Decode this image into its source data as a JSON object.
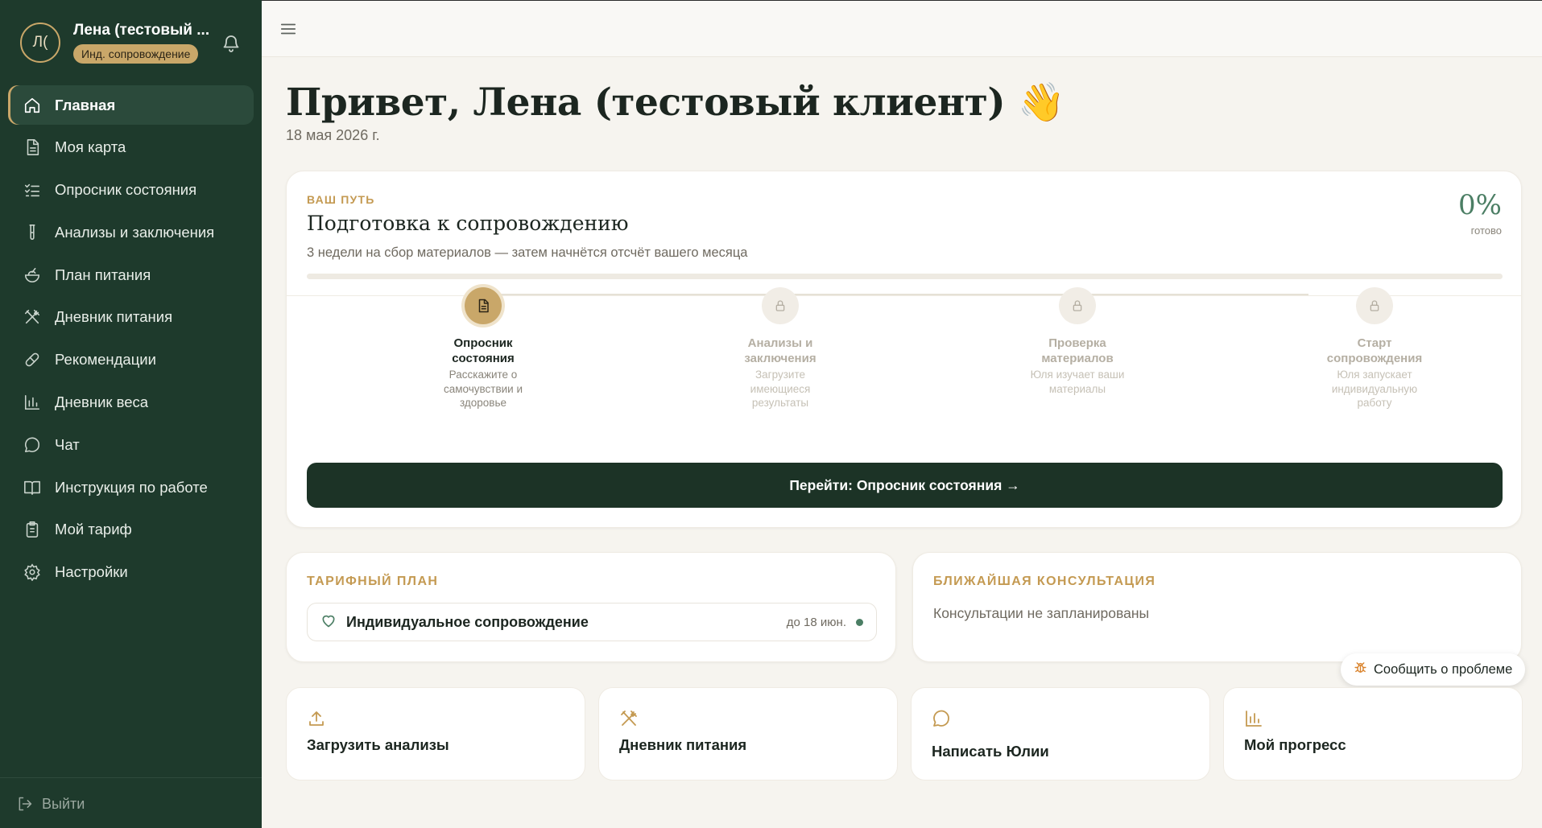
{
  "user": {
    "initials": "Л(",
    "name": "Лена (тестовый ...",
    "plan_badge": "Инд. сопровождение"
  },
  "sidebar": {
    "items": [
      {
        "label": "Главная",
        "icon": "home-icon",
        "active": true
      },
      {
        "label": "Моя карта",
        "icon": "document-icon"
      },
      {
        "label": "Опросник состояния",
        "icon": "checklist-icon"
      },
      {
        "label": "Анализы и заключения",
        "icon": "test-tube-icon"
      },
      {
        "label": "План питания",
        "icon": "salad-icon"
      },
      {
        "label": "Дневник питания",
        "icon": "utensils-icon"
      },
      {
        "label": "Рекомендации",
        "icon": "pill-icon"
      },
      {
        "label": "Дневник веса",
        "icon": "bar-chart-icon"
      },
      {
        "label": "Чат",
        "icon": "chat-bubble-icon"
      },
      {
        "label": "Инструкция по работе",
        "icon": "book-icon"
      },
      {
        "label": "Мой тариф",
        "icon": "clipboard-icon"
      },
      {
        "label": "Настройки",
        "icon": "gear-icon"
      }
    ],
    "logout_label": "Выйти"
  },
  "main": {
    "greeting": "Привет, Лена (тестовый клиент) 👋",
    "date": "18 мая 2026 г."
  },
  "path": {
    "eyebrow": "ВАШ ПУТЬ",
    "title": "Подготовка к сопровождению",
    "subtitle": "3 недели на сбор материалов — затем начнётся отсчёт вашего месяца",
    "percent": "0%",
    "percent_label": "готово",
    "progress": 0,
    "steps": [
      {
        "title": "Опросник состояния",
        "desc": "Расскажите о самочувствии и здоровье",
        "state": "active"
      },
      {
        "title": "Анализы и заключения",
        "desc": "Загрузите имеющиеся результаты",
        "state": "locked"
      },
      {
        "title": "Проверка материалов",
        "desc": "Юля изучает ваши материалы",
        "state": "locked"
      },
      {
        "title": "Старт сопровождения",
        "desc": "Юля запускает индивидуальную работу",
        "state": "locked"
      }
    ],
    "cta_label": "Перейти: Опросник состояния →"
  },
  "tariff": {
    "eyebrow": "ТАРИФНЫЙ ПЛАН",
    "name": "Индивидуальное сопровождение",
    "until": "до 18 июн."
  },
  "consultation": {
    "eyebrow": "БЛИЖАЙШАЯ КОНСУЛЬТАЦИЯ",
    "text": "Консультации не запланированы"
  },
  "report_problem_label": "Сообщить о проблеме",
  "quick_actions": [
    {
      "label": "Загрузить анализы",
      "icon": "upload-icon"
    },
    {
      "label": "Дневник питания",
      "icon": "utensils-icon"
    },
    {
      "label": "Написать Юлии",
      "icon": "chat-bubble-icon"
    },
    {
      "label": "Мой прогресс",
      "icon": "bar-chart-icon"
    }
  ],
  "colors": {
    "sidebar_bg": "#1e3a2c",
    "accent_gold": "#c9a769",
    "accent_green": "#4b7e64",
    "cta_bg": "#1c3326",
    "page_bg": "#f6f4ef"
  }
}
